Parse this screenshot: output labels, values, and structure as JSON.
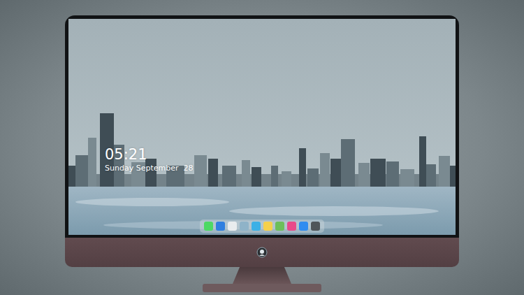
{
  "desktop": {
    "time": "05:21",
    "date": "Sunday September  28"
  },
  "dock": {
    "items": [
      {
        "color": "#4cd964"
      },
      {
        "color": "#2f7fe0"
      },
      {
        "color": "#e9ecee"
      },
      {
        "color": "#8fb3c8"
      },
      {
        "color": "#3bb0e6"
      },
      {
        "color": "#f5d04c"
      },
      {
        "color": "#6cbf5a"
      },
      {
        "color": "#e84a8a"
      },
      {
        "color": "#2f8cf0"
      },
      {
        "color": "#4f5559"
      }
    ]
  }
}
